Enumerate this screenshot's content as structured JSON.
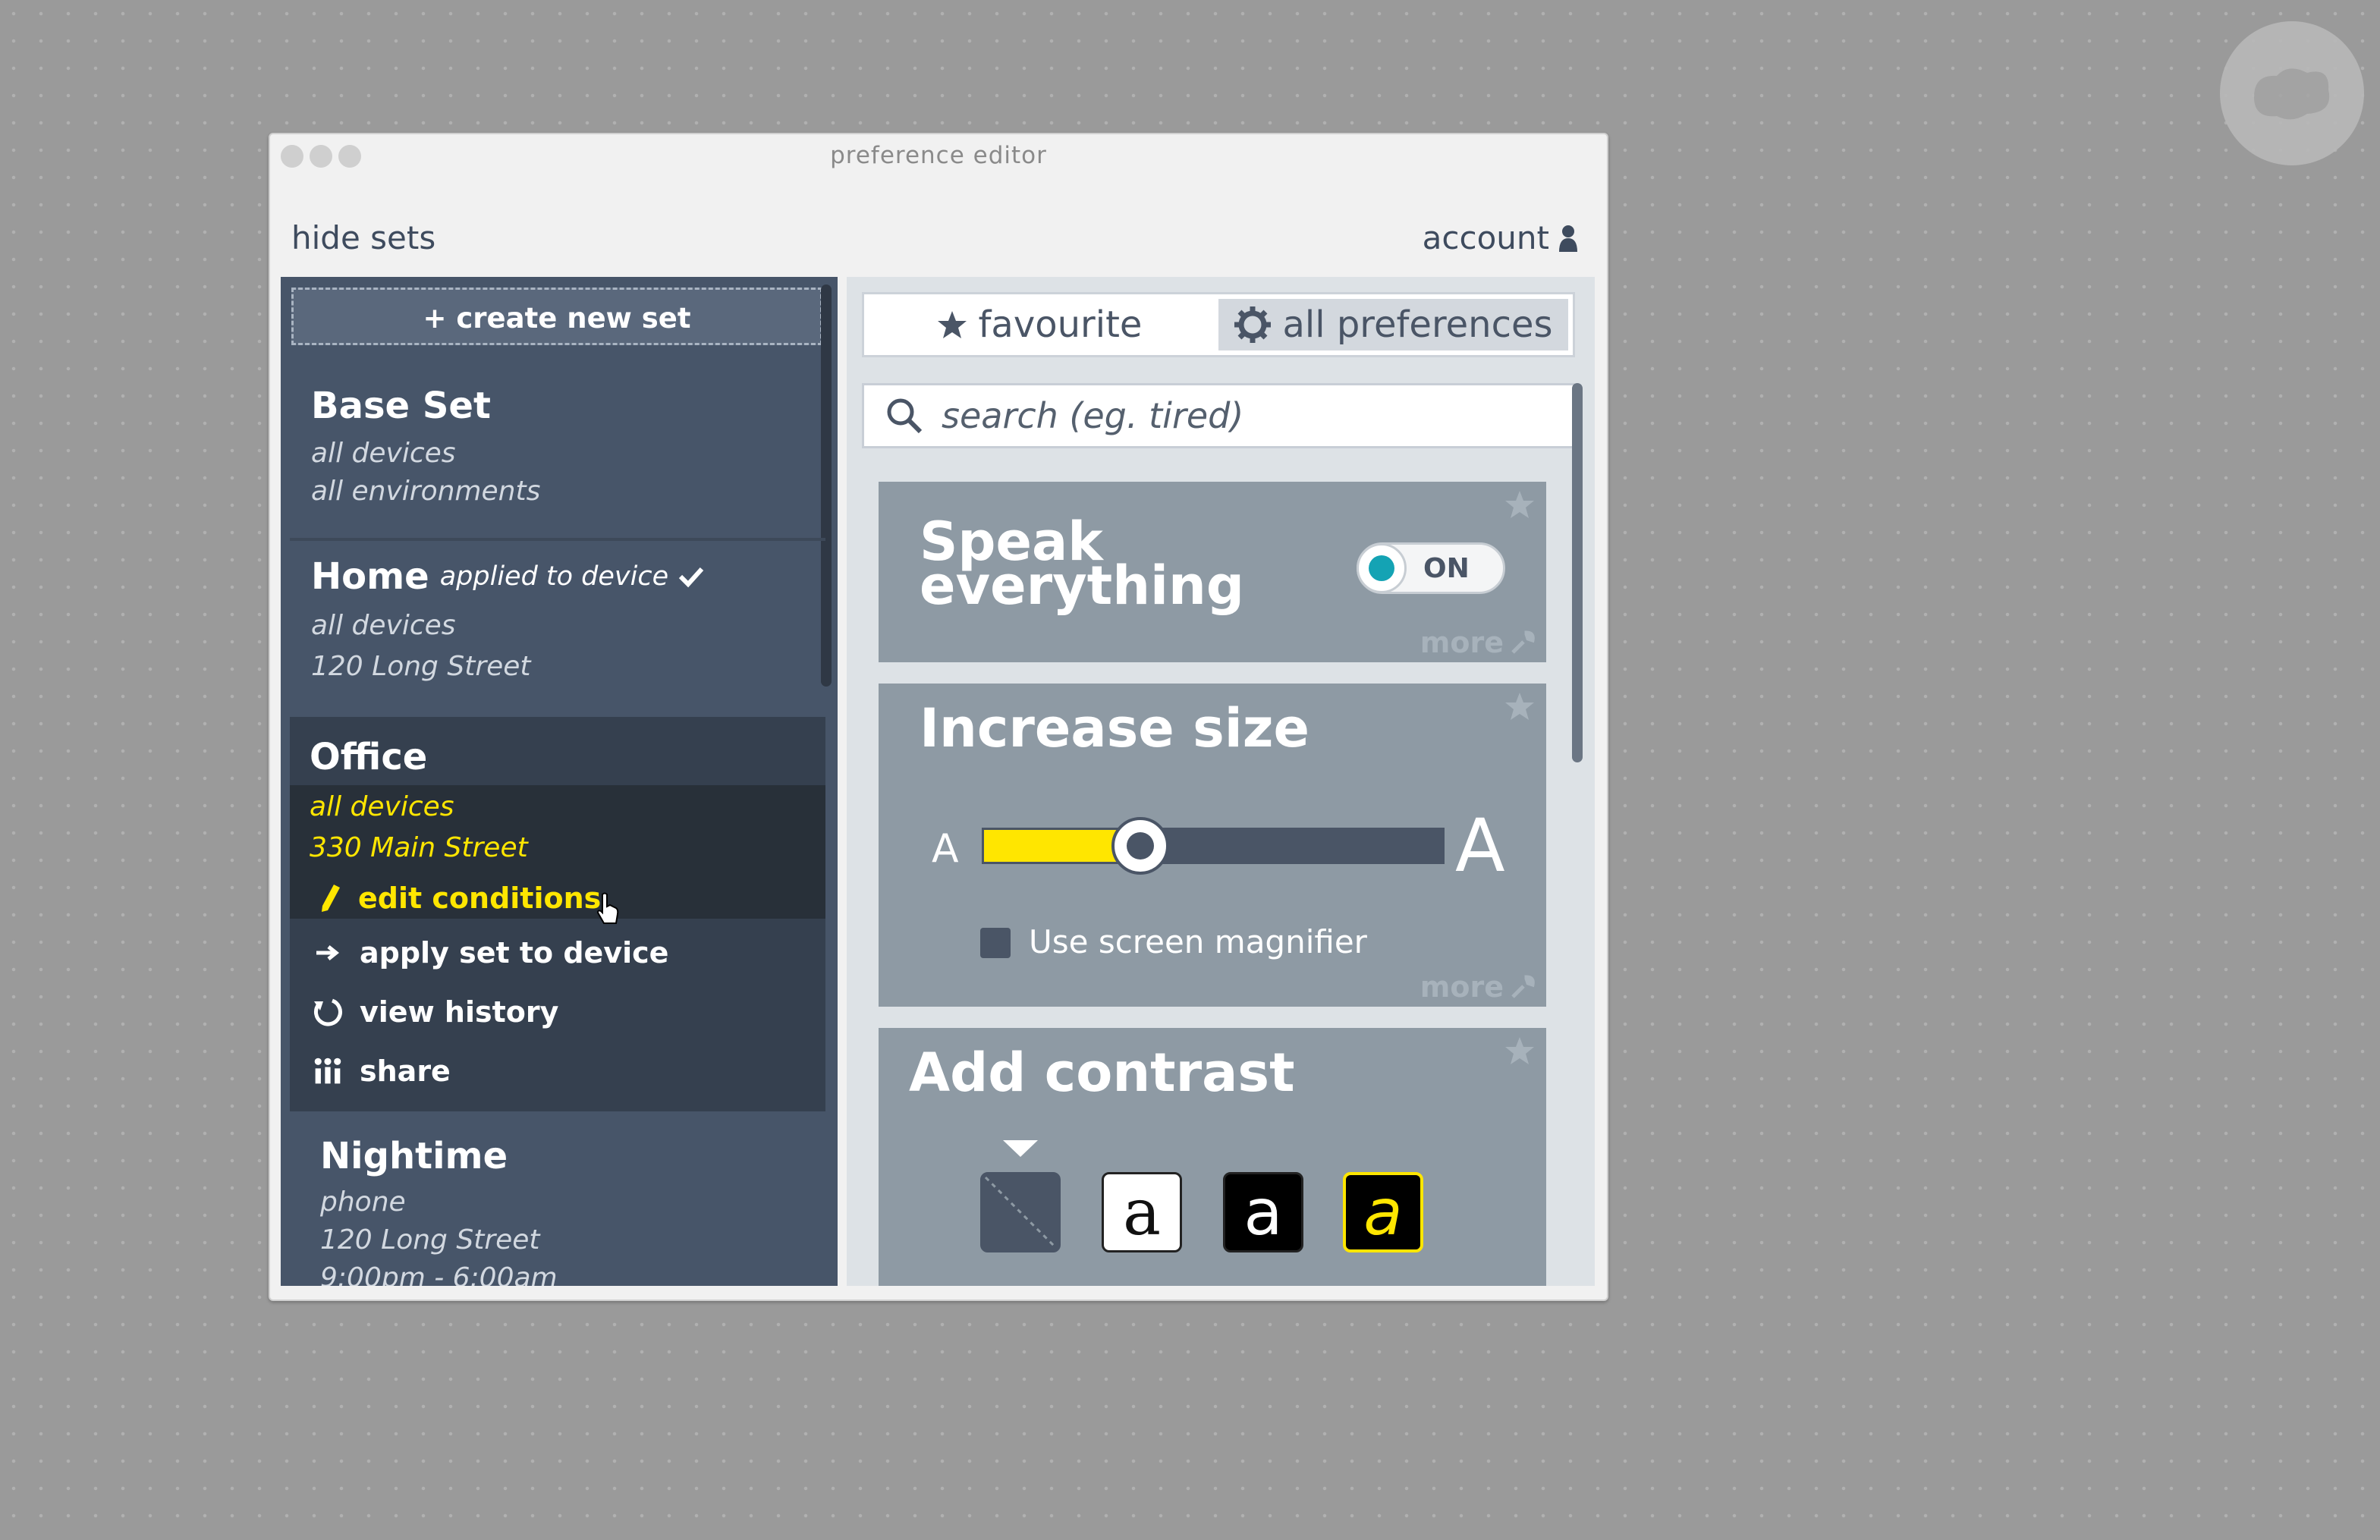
{
  "window": {
    "title": "preference editor"
  },
  "header": {
    "hide_sets": "hide sets",
    "account": "account"
  },
  "sets_panel": {
    "create_label": "+ create new set",
    "sets": [
      {
        "name": "Base Set",
        "meta": [
          "all devices",
          "all environments"
        ]
      },
      {
        "name": "Home",
        "status": "applied to device",
        "meta": [
          "all devices",
          "120 Long Street"
        ]
      },
      {
        "name": "Office",
        "meta": [
          "all devices",
          "330 Main Street"
        ],
        "edit_label": "edit conditions",
        "actions": [
          "apply set to device",
          "view history",
          "share"
        ]
      },
      {
        "name": "Nightime",
        "meta": [
          "phone",
          "120 Long Street",
          "9:00pm - 6:00am"
        ]
      }
    ]
  },
  "prefs_panel": {
    "tabs": [
      {
        "label": "favourite",
        "active": false
      },
      {
        "label": "all preferences",
        "active": true
      }
    ],
    "search_placeholder": "search (eg. tired)",
    "cards": {
      "speak": {
        "title_line1": "Speak",
        "title_line2": "everything",
        "toggle_label": "ON",
        "toggle_state": true,
        "more": "more"
      },
      "size": {
        "title": "Increase size",
        "small_a": "A",
        "large_a": "A",
        "slider_value": 0.28,
        "magnifier_label": "Use screen magnifier",
        "magnifier_checked": false,
        "more": "more"
      },
      "contrast": {
        "title": "Add contrast",
        "options": [
          {
            "name": "none",
            "letter": ""
          },
          {
            "name": "black-on-white",
            "letter": "a"
          },
          {
            "name": "white-on-black",
            "letter": "a"
          },
          {
            "name": "yellow-on-black",
            "letter": "a"
          }
        ],
        "selected": 0
      }
    }
  },
  "colors": {
    "accent_yellow": "#ffe600",
    "toggle_on": "#14a3b4",
    "panel": "#475569",
    "card": "#8e9aa4"
  }
}
